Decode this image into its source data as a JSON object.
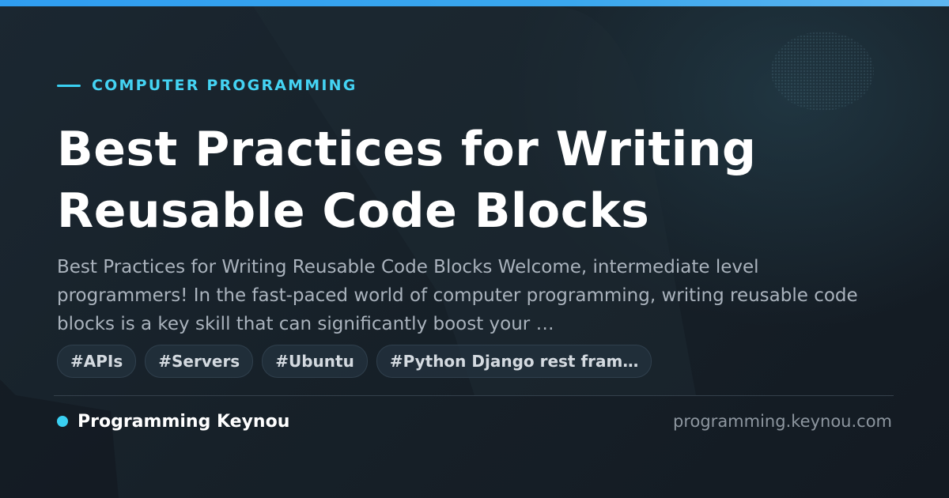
{
  "card": {
    "category": "COMPUTER PROGRAMMING",
    "title": "Best Practices for Writing Reusable Code Blocks",
    "description": "Best Practices for Writing Reusable Code Blocks Welcome, intermediate level programmers! In the fast-paced world of computer programming, writing reusable code blocks is a key skill that can significantly boost your …",
    "tags": [
      "#APIs",
      "#Servers",
      "#Ubuntu",
      "#Python Django rest fram…"
    ],
    "brand": "Programming Keynou",
    "domain": "programming.keynou.com"
  },
  "colors": {
    "accent": "#3ad0f2",
    "top_bar": "#2f9df0",
    "background": "#141b24",
    "title": "#ffffff",
    "description": "#aab3bd",
    "tag_background": "#22303c",
    "domain": "#8d969f"
  }
}
